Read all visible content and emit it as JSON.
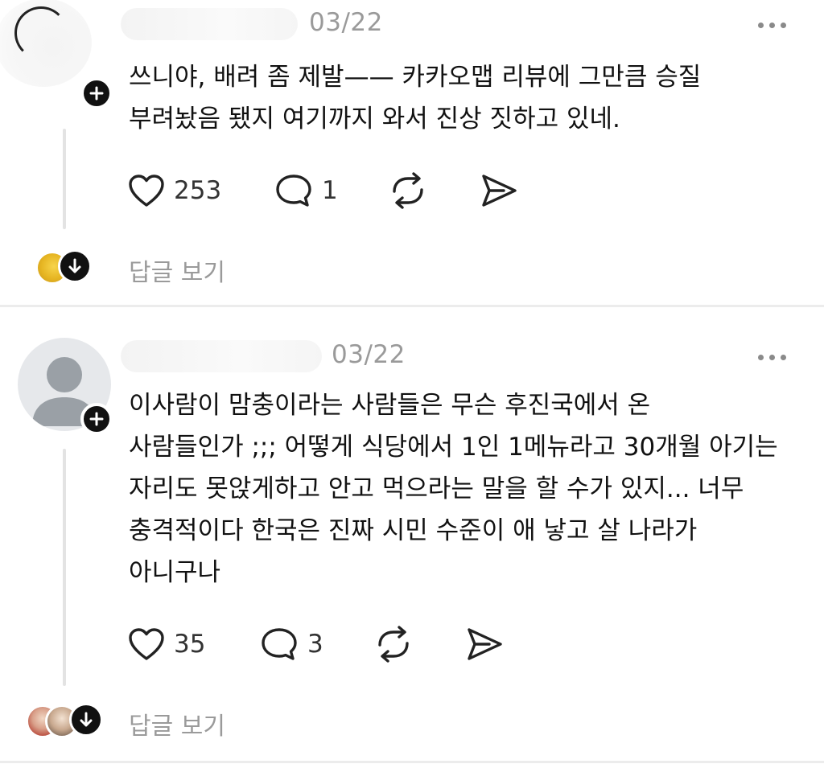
{
  "comments": [
    {
      "date": "03/22",
      "lines": [
        "쓰니야, 배려 좀 제발—— 카카오맵 리뷰에 그만큼 승질",
        "부려놨음 됐지 여기까지 와서 진상 짓하고 있네."
      ],
      "likes": "253",
      "replies": "1",
      "view_replies_label": "답글 보기"
    },
    {
      "date": "03/22",
      "lines": [
        "이사람이 맘충이라는 사람들은 무슨 후진국에서 온",
        "사람들인가 ;;; 어떻게 식당에서 1인 1메뉴라고 30개월 아기는",
        "자리도 못앉게하고 안고 먹으라는 말을 할 수가 있지... 너무",
        "충격적이다 한국은 진짜 시민 수준이 애 낳고 살 나라가",
        "아니구나"
      ],
      "likes": "35",
      "replies": "3",
      "view_replies_label": "답글 보기"
    }
  ],
  "icons": {
    "like": "heart-icon",
    "reply": "speech-bubble-icon",
    "repost": "repost-icon",
    "share": "send-icon",
    "more": "more-icon",
    "follow": "plus-icon",
    "expand": "arrow-down-icon"
  },
  "colors": {
    "text": "#111111",
    "muted": "#9a9a9a",
    "badge": "#111111",
    "divider": "#ececec"
  }
}
